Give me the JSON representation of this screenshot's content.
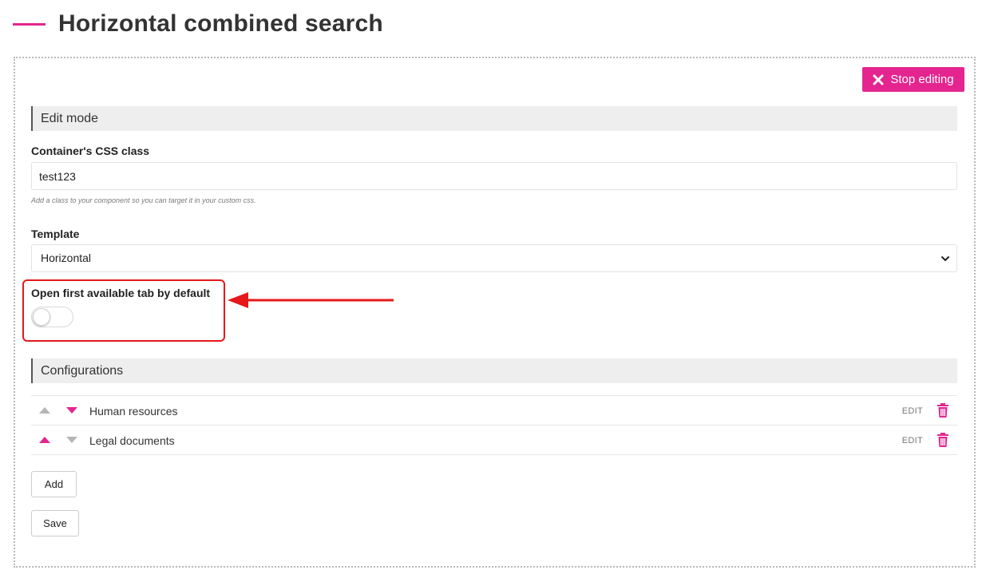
{
  "page": {
    "title": "Horizontal combined search"
  },
  "toolbar": {
    "stop_editing_label": "Stop editing"
  },
  "edit_mode": {
    "section_title": "Edit mode",
    "css_class": {
      "label": "Container's CSS class",
      "value": "test123",
      "help": "Add a class to your component so you can target it in your custom css."
    },
    "template": {
      "label": "Template",
      "selected": "Horizontal"
    },
    "open_first_tab": {
      "label": "Open first available tab by default",
      "enabled": false
    }
  },
  "configurations": {
    "section_title": "Configurations",
    "items": [
      {
        "label": "Human resources",
        "edit_label": "EDIT",
        "up_enabled": false,
        "down_enabled": true
      },
      {
        "label": "Legal documents",
        "edit_label": "EDIT",
        "up_enabled": true,
        "down_enabled": false
      }
    ]
  },
  "actions": {
    "add_label": "Add",
    "save_label": "Save"
  },
  "colors": {
    "accent": "#e4258f",
    "callout": "#e5191a",
    "disabled_arrow": "#b5b5b5",
    "section_bg": "#eeeeee"
  },
  "icons": [
    "close-icon",
    "chevron-down-icon",
    "arrow-up-icon",
    "arrow-down-icon",
    "trash-icon",
    "callout-arrow"
  ]
}
